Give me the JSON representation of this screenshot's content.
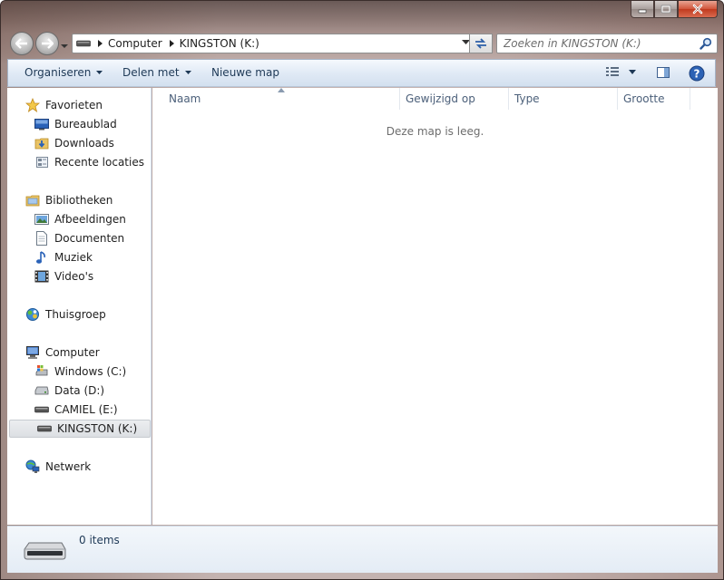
{
  "window": {
    "controls": [
      "minimize",
      "maximize",
      "close"
    ]
  },
  "address": {
    "crumbs": [
      "Computer",
      "KINGSTON (K:)"
    ]
  },
  "search": {
    "placeholder": "Zoeken in KINGSTON (K:)"
  },
  "toolbar": {
    "organize": "Organiseren",
    "share": "Delen met",
    "new_folder": "Nieuwe map"
  },
  "sidebar": {
    "favorites": {
      "label": "Favorieten",
      "items": [
        "Bureaublad",
        "Downloads",
        "Recente locaties"
      ]
    },
    "libraries": {
      "label": "Bibliotheken",
      "items": [
        "Afbeeldingen",
        "Documenten",
        "Muziek",
        "Video's"
      ]
    },
    "homegroup": {
      "label": "Thuisgroep"
    },
    "computer": {
      "label": "Computer",
      "items": [
        "Windows (C:)",
        "Data (D:)",
        "CAMIEL (E:)",
        "KINGSTON (K:)"
      ],
      "selected": "KINGSTON (K:)"
    },
    "network": {
      "label": "Netwerk"
    }
  },
  "columns": [
    "Naam",
    "Gewijzigd op",
    "Type",
    "Grootte"
  ],
  "content": {
    "empty_message": "Deze map is leeg."
  },
  "status": {
    "count": "0 items"
  },
  "colors": {
    "accent": "#1e3956",
    "command_bar": "#dfe9f5",
    "selection": "#dcdfe3"
  }
}
